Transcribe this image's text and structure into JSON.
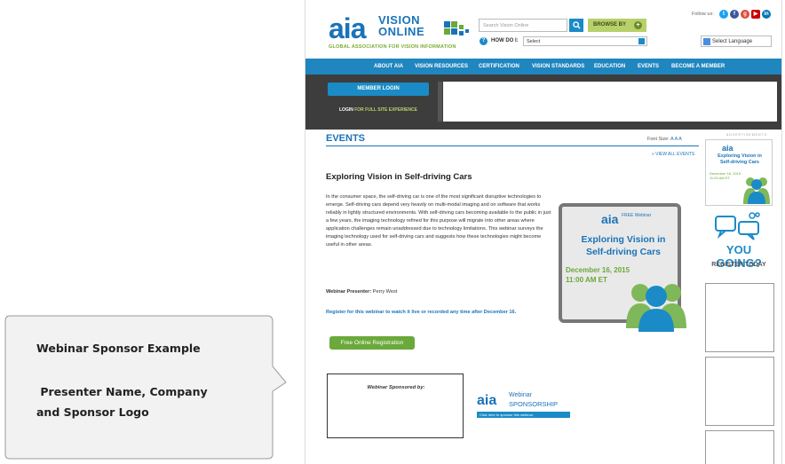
{
  "header": {
    "logo_aia": "aia",
    "logo_vision": "VISION",
    "logo_online": "ONLINE",
    "tagline": "GLOBAL ASSOCIATION FOR VISION INFORMATION",
    "search_placeholder": "Search Vision Online",
    "browse_label": "BROWSE BY",
    "howdo_label": "HOW DO I:",
    "howdo_value": "Select",
    "follow_label": "Follow us:",
    "language_label": "Select Language"
  },
  "nav": {
    "items": [
      "ABOUT AIA",
      "VISION RESOURCES",
      "CERTIFICATION",
      "VISION STANDARDS",
      "EDUCATION",
      "EVENTS",
      "BECOME A MEMBER"
    ]
  },
  "banner": {
    "member_login": "MEMBER LOGIN",
    "login_prefix": "LOGIN",
    "login_suffix": "FOR FULL SITE EXPERIENCE"
  },
  "events": {
    "title": "EVENTS",
    "font_size_label": "Font Size:",
    "font_sizes": "A A A",
    "view_all": "» VIEW ALL EVENTS",
    "article_title": "Exploring Vision in Self-driving Cars",
    "article_body": "In the consumer space, the self-driving car is one of the most significant disruptive technologies to emerge. Self-driving cars depend very heavily on multi-modal imaging and on software that works reliably in lightly structured environments. With self-driving cars becoming available to the public in just a few years, the imaging technology refined for this purpose will migrate into other areas where application challenges remain unaddressed due to technology limitations. This webinar surveys the imaging technology used for self-driving cars and suggests how these technologies might become useful in other areas.",
    "presenter_label": "Webinar Presenter:",
    "presenter_name": "Perry West",
    "register_text": "Register for this webinar to watch it live or recorded any time after December 16.",
    "registration_button": "Free Online Registration"
  },
  "webinar_card": {
    "aia": "aia",
    "free_webinar": "FREE Webinar",
    "title": "Exploring Vision in Self-driving Cars",
    "date": "December 16, 2015",
    "time": "11:00 AM ET"
  },
  "sponsor": {
    "box_label": "Webinar Sponsored by:",
    "ad_aia": "aia",
    "ad_webinar": "Webinar",
    "ad_sponsorship": "SPONSORSHIP",
    "ad_click": "Click here to sponsor this webinar."
  },
  "sidebar": {
    "advertisements": "ADVERTISEMENTS",
    "ad_aia": "aia",
    "ad_title": "Exploring Vision in Self-driving Cars",
    "ad_date": "December 16, 2015",
    "ad_time": "11:00 AM ET",
    "you_going": "YOU GOING?",
    "register_today": "REGISTER TODAY"
  },
  "callout": {
    "line1": "Webinar Sponsor Example",
    "line2": " Presenter Name, Company",
    "line3": "and Sponsor Logo"
  },
  "colors": {
    "brand_blue": "#1a73b8",
    "nav_blue": "#1f86c0",
    "brand_green": "#6aa93a",
    "banner_dark": "#3d3d3d"
  }
}
